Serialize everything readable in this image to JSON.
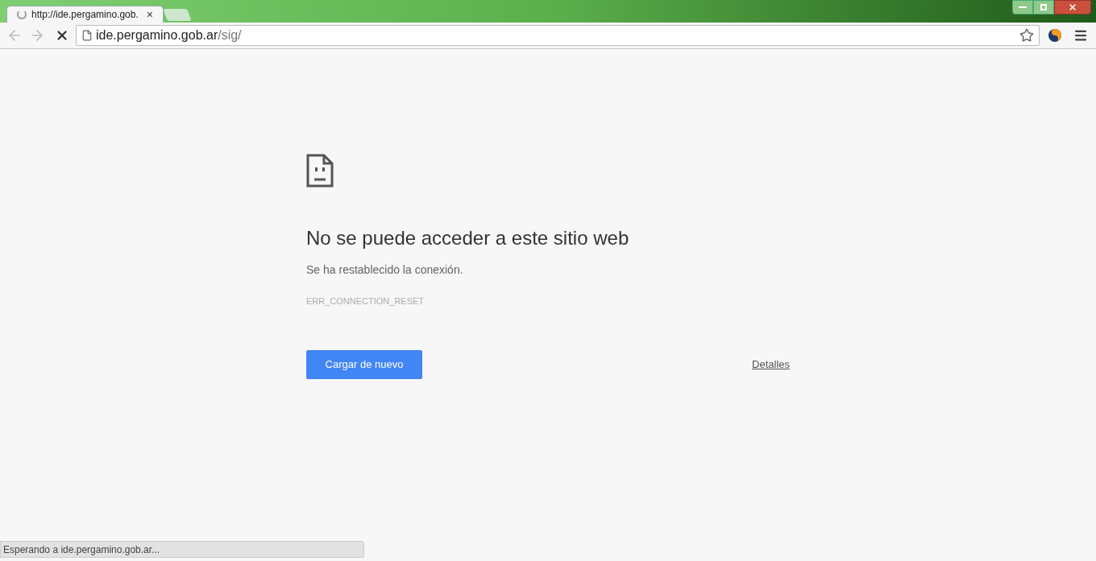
{
  "tab": {
    "title": "http://ide.pergamino.gob.",
    "close": "×",
    "loading": true
  },
  "toolbar": {
    "url_host": "ide.pergamino.gob.ar",
    "url_path": "/sig/",
    "back_disabled": true,
    "forward_disabled": true
  },
  "error": {
    "heading": "No se puede acceder a este sitio web",
    "message": "Se ha restablecido la conexión.",
    "code": "ERR_CONNECTION_RESET",
    "reload_button": "Cargar de nuevo",
    "details_link": "Detalles"
  },
  "status_bar": "Esperando a ide.pergamino.gob.ar..."
}
